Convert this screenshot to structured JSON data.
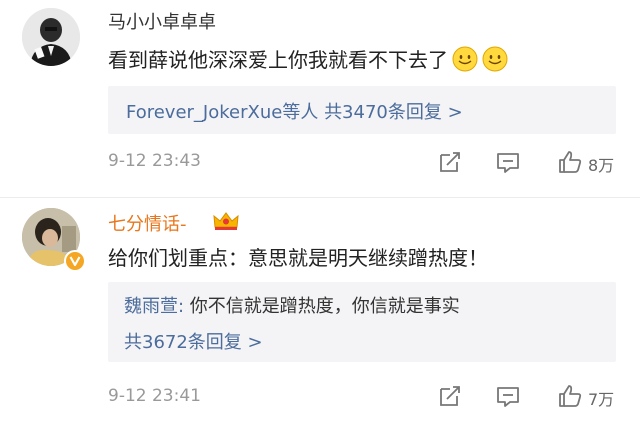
{
  "comments": [
    {
      "username": "马小小卓卓卓",
      "text": "看到薛说他深深爱上你我就看不下去了",
      "emoji": [
        "smile-emoji",
        "smile-emoji"
      ],
      "reply_summary": {
        "users": "Forever_JokerXue等人",
        "count": "共3470条回复",
        "arrow": ">"
      },
      "time": "9-12 23:43",
      "likes": "8万",
      "icons": [
        "share-icon",
        "comment-icon",
        "like-icon"
      ]
    },
    {
      "username": "七分情话-",
      "text": "给你们划重点：意思就是明天继续蹭热度！",
      "badge": "vip-crown-icon",
      "verified": "v-badge-icon",
      "reply_preview": {
        "author": "魏雨萱:",
        "content": " 你不信就是蹭热度，你信就是事实"
      },
      "reply_summary": {
        "count": "共3672条回复",
        "arrow": ">"
      },
      "time": "9-12 23:41",
      "likes": "7万",
      "icons": [
        "share-icon",
        "comment-icon",
        "like-icon"
      ]
    }
  ],
  "colors": {
    "link": "#4b6c9c",
    "vip_name": "#e8761a",
    "reply_bg": "#f4f4f6",
    "meta": "#999999"
  }
}
